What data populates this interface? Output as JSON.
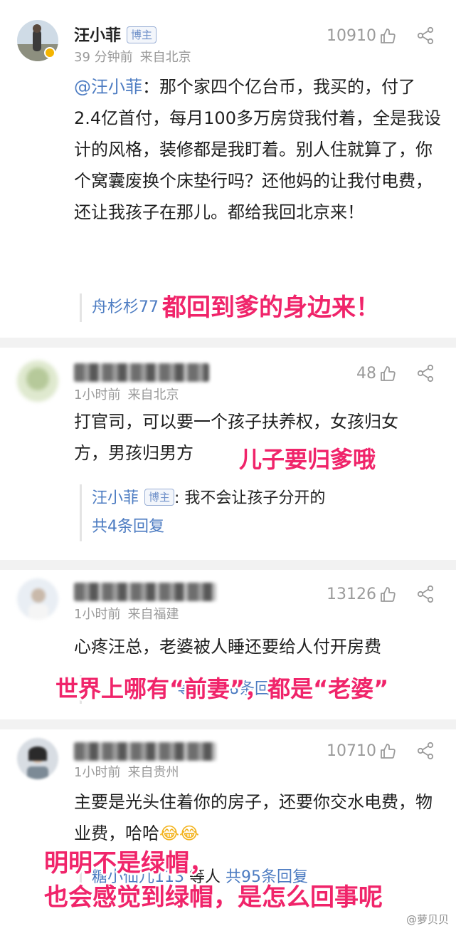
{
  "comments": [
    {
      "username": "汪小菲",
      "author_badge": "博主",
      "time": "39 分钟前",
      "location": "来自北京",
      "likes": "10910",
      "mention": "@汪小菲",
      "text": "：那个家四个亿台币，我买的，付了2.4亿首付，每月100多万房贷我付着，全是我设计的风格，装修都是我盯着。别人住就算了，你个窝囊废换个床垫行吗？还他妈的让我付电费，还让我孩子在那儿。都给我回北京来！",
      "reply_partial": "舟杉杉77"
    },
    {
      "time": "1小时前",
      "location": "来自北京",
      "likes": "48",
      "text": "打官司，可以要一个孩子扶养权，女孩归女方，男孩归男方",
      "reply": {
        "name": "汪小菲",
        "badge": "博主",
        "text": ": 我不会让孩子分开的",
        "more": "共4条回复"
      }
    },
    {
      "time": "1小时前",
      "location": "来自福建",
      "likes": "13126",
      "text": "心疼汪总，老婆被人睡还要给人付开房费",
      "reply_partial": "等人 共8条回复"
    },
    {
      "time": "1小时前",
      "location": "来自贵州",
      "likes": "10710",
      "text": "主要是光头住着你的房子，还要你交水电费，物业费，哈哈",
      "emoji": "😂😂",
      "reply_partial_name": "糖小仙儿113",
      "reply_partial_rest": "等人",
      "reply_partial_more": "共95条回复"
    }
  ],
  "overlays": {
    "caption1": "都回到爹的身边来！",
    "caption2": "儿子要归爹哦",
    "caption3": "世界上哪有“前妻”，都是“老婆”",
    "caption4_line1": "明明不是绿帽，",
    "caption4_line2": "也会感觉到绿帽，是怎么回事呢"
  },
  "watermark": "@萝贝贝",
  "colors": {
    "overlay": "#f0246a",
    "link": "#4d7cc2",
    "meta": "#999999"
  },
  "icons": [
    "like-icon",
    "share-icon",
    "verified-icon"
  ]
}
